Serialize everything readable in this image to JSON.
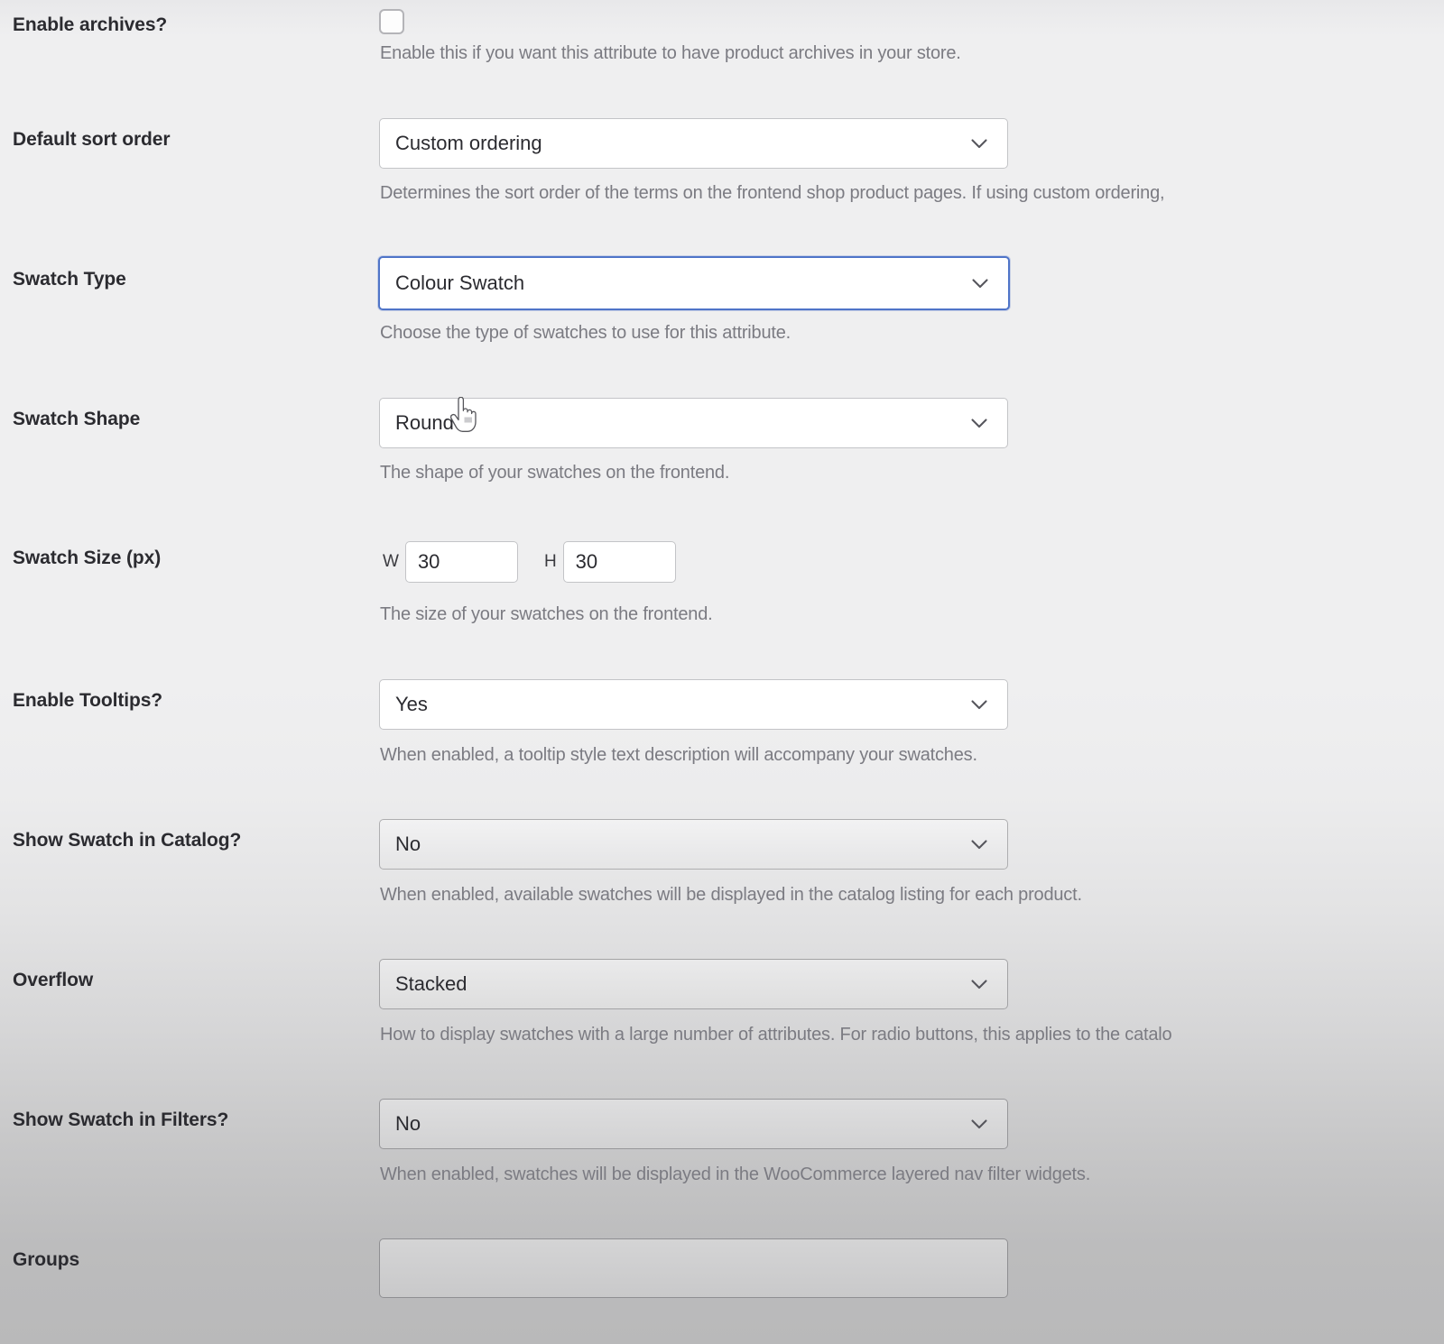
{
  "form": {
    "fields": [
      {
        "id": "enable-archives",
        "label": "Enable archives?",
        "control": "checkbox",
        "checked": false,
        "description": "Enable this if you want this attribute to have product archives in your store."
      },
      {
        "id": "default-sort-order",
        "label": "Default sort order",
        "control": "select",
        "value": "Custom ordering",
        "description": "Determines the sort order of the terms on the frontend shop product pages. If using custom ordering,"
      },
      {
        "id": "swatch-type",
        "label": "Swatch Type",
        "control": "select",
        "value": "Colour Swatch",
        "focused": true,
        "description": "Choose the type of swatches to use for this attribute."
      },
      {
        "id": "swatch-shape",
        "label": "Swatch Shape",
        "control": "select",
        "value": "Round",
        "description": "The shape of your swatches on the frontend."
      },
      {
        "id": "swatch-size",
        "label": "Swatch Size (px)",
        "control": "size",
        "width_prefix": "W",
        "width_value": "30",
        "height_prefix": "H",
        "height_value": "30",
        "description": "The size of your swatches on the frontend."
      },
      {
        "id": "enable-tooltips",
        "label": "Enable Tooltips?",
        "control": "select",
        "value": "Yes",
        "description": "When enabled, a tooltip style text description will accompany your swatches."
      },
      {
        "id": "show-swatch-in-catalog",
        "label": "Show Swatch in Catalog?",
        "control": "select",
        "value": "No",
        "description": "When enabled, available swatches will be displayed in the catalog listing for each product."
      },
      {
        "id": "overflow",
        "label": "Overflow",
        "control": "select",
        "value": "Stacked",
        "description": "How to display swatches with a large number of attributes. For radio buttons, this applies to the catalo"
      },
      {
        "id": "show-swatch-in-filters",
        "label": "Show Swatch in Filters?",
        "control": "select",
        "value": "No",
        "description": "When enabled, swatches will be displayed in the WooCommerce layered nav filter widgets."
      },
      {
        "id": "groups",
        "label": "Groups",
        "control": "text",
        "value": "",
        "description": ""
      }
    ]
  },
  "icons": {
    "chevron": "chevron-down-icon",
    "cursor": "pointer-hand-cursor",
    "checkbox": "checkbox-unchecked-icon"
  },
  "colors": {
    "focus_border": "#4f74c8",
    "label_text": "#2b2b30",
    "description_text": "#7b7b82",
    "field_border": "#c3c4c7"
  }
}
